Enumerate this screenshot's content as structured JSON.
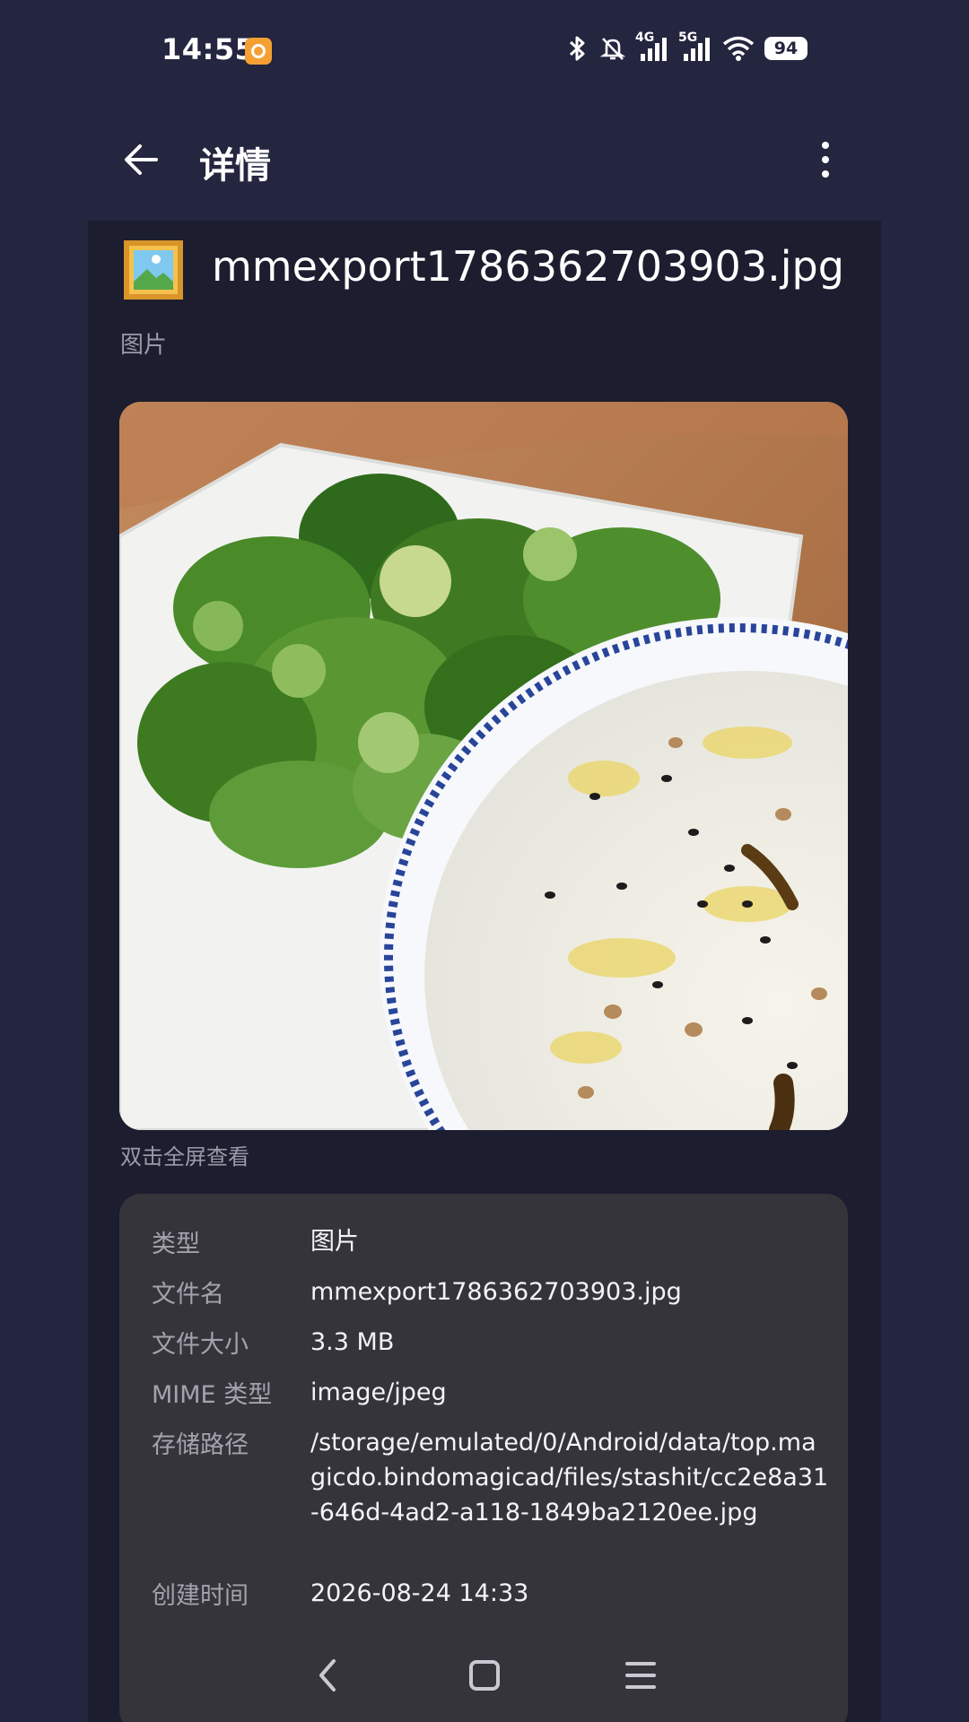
{
  "status_bar": {
    "time": "14:55",
    "network_4g": "4G",
    "network_5g": "5G",
    "battery": "94",
    "icons": [
      "app-notification-icon",
      "bluetooth-icon",
      "mute-icon",
      "signal-icon",
      "wifi-icon",
      "battery-icon"
    ]
  },
  "app_bar": {
    "title": "详情",
    "back_icon": "arrow-left-icon",
    "more_icon": "more-vertical-icon"
  },
  "file": {
    "icon": "picture-frame-icon",
    "name": "mmexport1786362703903.jpg",
    "category": "图片",
    "preview_hint": "双击全屏查看"
  },
  "details": [
    {
      "label": "类型",
      "value": "图片"
    },
    {
      "label": "文件名",
      "value": "mmexport1786362703903.jpg"
    },
    {
      "label": "文件大小",
      "value": "3.3 MB"
    },
    {
      "label": "MIME 类型",
      "value": "image/jpeg"
    },
    {
      "label": "存储路径",
      "value": "/storage/emulated/0/Android/data/top.magicdo.bindomagicad/files/stashit/cc2e8a31-646d-4ad2-a118-1849ba2120ee.jpg"
    },
    {
      "label": "创建时间",
      "value": "2026-08-24 14:33"
    }
  ],
  "nav_bar": {
    "icons": [
      "nav-back-icon",
      "nav-home-icon",
      "nav-menu-icon"
    ]
  }
}
